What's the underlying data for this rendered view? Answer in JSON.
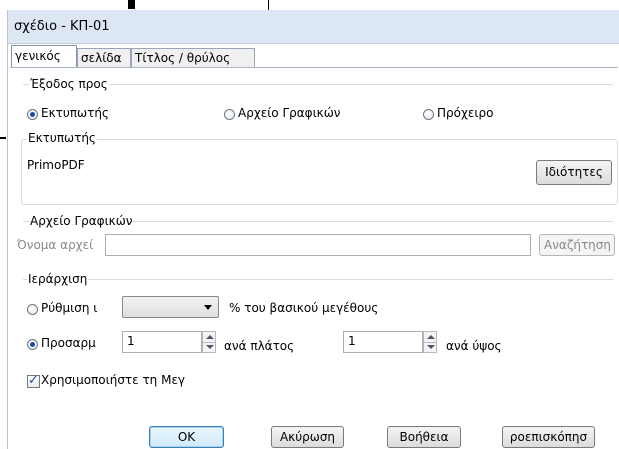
{
  "window": {
    "title": "σχέδιο - ΚΠ-01"
  },
  "tabs": [
    {
      "label": "γενικός",
      "active": true
    },
    {
      "label": "σελίδα",
      "active": false
    },
    {
      "label": "Τίτλος / θρύλος",
      "active": false
    }
  ],
  "output": {
    "legend": "Έξοδος προς",
    "options": [
      {
        "label": "Εκτυπωτής",
        "checked": true
      },
      {
        "label": "Αρχείο Γραφικών",
        "checked": false
      },
      {
        "label": "Πρόχειρο",
        "checked": false
      }
    ]
  },
  "printer": {
    "legend": "Εκτυπωτής",
    "name": "PrimoPDF",
    "properties_label": "Ιδιότητες"
  },
  "graphics_file": {
    "legend": "Αρχείο Γραφικών",
    "filename_label": "Όνομα αρχεί",
    "filename_value": "",
    "browse_label": "Αναζήτηση"
  },
  "scaling": {
    "legend": "Ιεράρχιση",
    "set_label": "Ρύθμιση ι",
    "set_checked": false,
    "percent_value": "",
    "percent_label": "% του βασικού μεγέθους",
    "fit_label": "Προσαρμ",
    "fit_checked": true,
    "width_value": "1",
    "width_label": "ανά πλάτος",
    "height_value": "1",
    "height_label": "ανά ύψος",
    "use_label": "Χρησιμοποιήστε τη Μεγ",
    "use_checked": true
  },
  "buttons": {
    "ok": "OK",
    "cancel": "Ακύρωση",
    "help": "Βοήθεια",
    "preview": "ροεπισκόπησ"
  },
  "colors": {
    "titlebar": "#dde7f3",
    "accent": "#1d4aa8"
  }
}
